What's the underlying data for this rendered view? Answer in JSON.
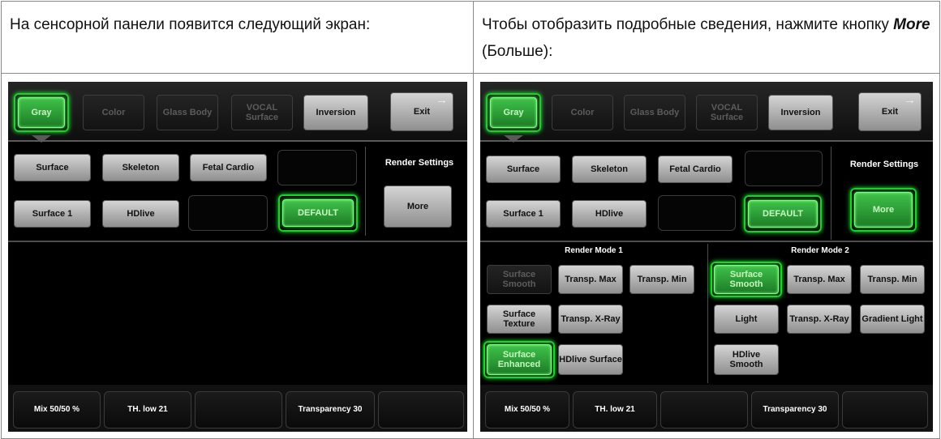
{
  "left_caption": "На сенсорной панели появится следующий экран:",
  "right_caption_before": "Чтобы отобразить подробные сведения, нажмите кнопку ",
  "right_caption_em": "More",
  "right_caption_after": " (Больше):",
  "panel": {
    "tabs": {
      "gray": "Gray",
      "color": "Color",
      "glass_body": "Glass Body",
      "vocal_surface": "VOCAL Surface",
      "inversion": "Inversion",
      "exit": "Exit"
    },
    "presets": {
      "surface": "Surface",
      "skeleton": "Skeleton",
      "fetal_cardio": "Fetal Cardio",
      "surface1": "Surface 1",
      "hdlive": "HDlive",
      "default": "DEFAULT"
    },
    "render_settings": "Render Settings",
    "more": "More",
    "render_mode_1": {
      "title": "Render Mode 1",
      "surface_smooth": "Surface Smooth",
      "transp_max": "Transp. Max",
      "transp_min": "Transp. Min",
      "surface_texture": "Surface Texture",
      "transp_xray": "Transp. X-Ray",
      "surface_enhanced": "Surface Enhanced",
      "hdlive_surface": "HDlive Surface"
    },
    "render_mode_2": {
      "title": "Render Mode 2",
      "surface_smooth": "Surface Smooth",
      "transp_max": "Transp. Max",
      "transp_min": "Transp. Min",
      "light": "Light",
      "transp_xray": "Transp. X-Ray",
      "gradient_light": "Gradient Light",
      "hdlive_smooth": "HDlive Smooth"
    },
    "softkeys": {
      "mix": "Mix 50/50 %",
      "th_low": "TH. low 21",
      "transparency": "Transparency 30"
    }
  },
  "colors": {
    "accent_green": "#1ad02b",
    "panel_bg": "#000000"
  }
}
